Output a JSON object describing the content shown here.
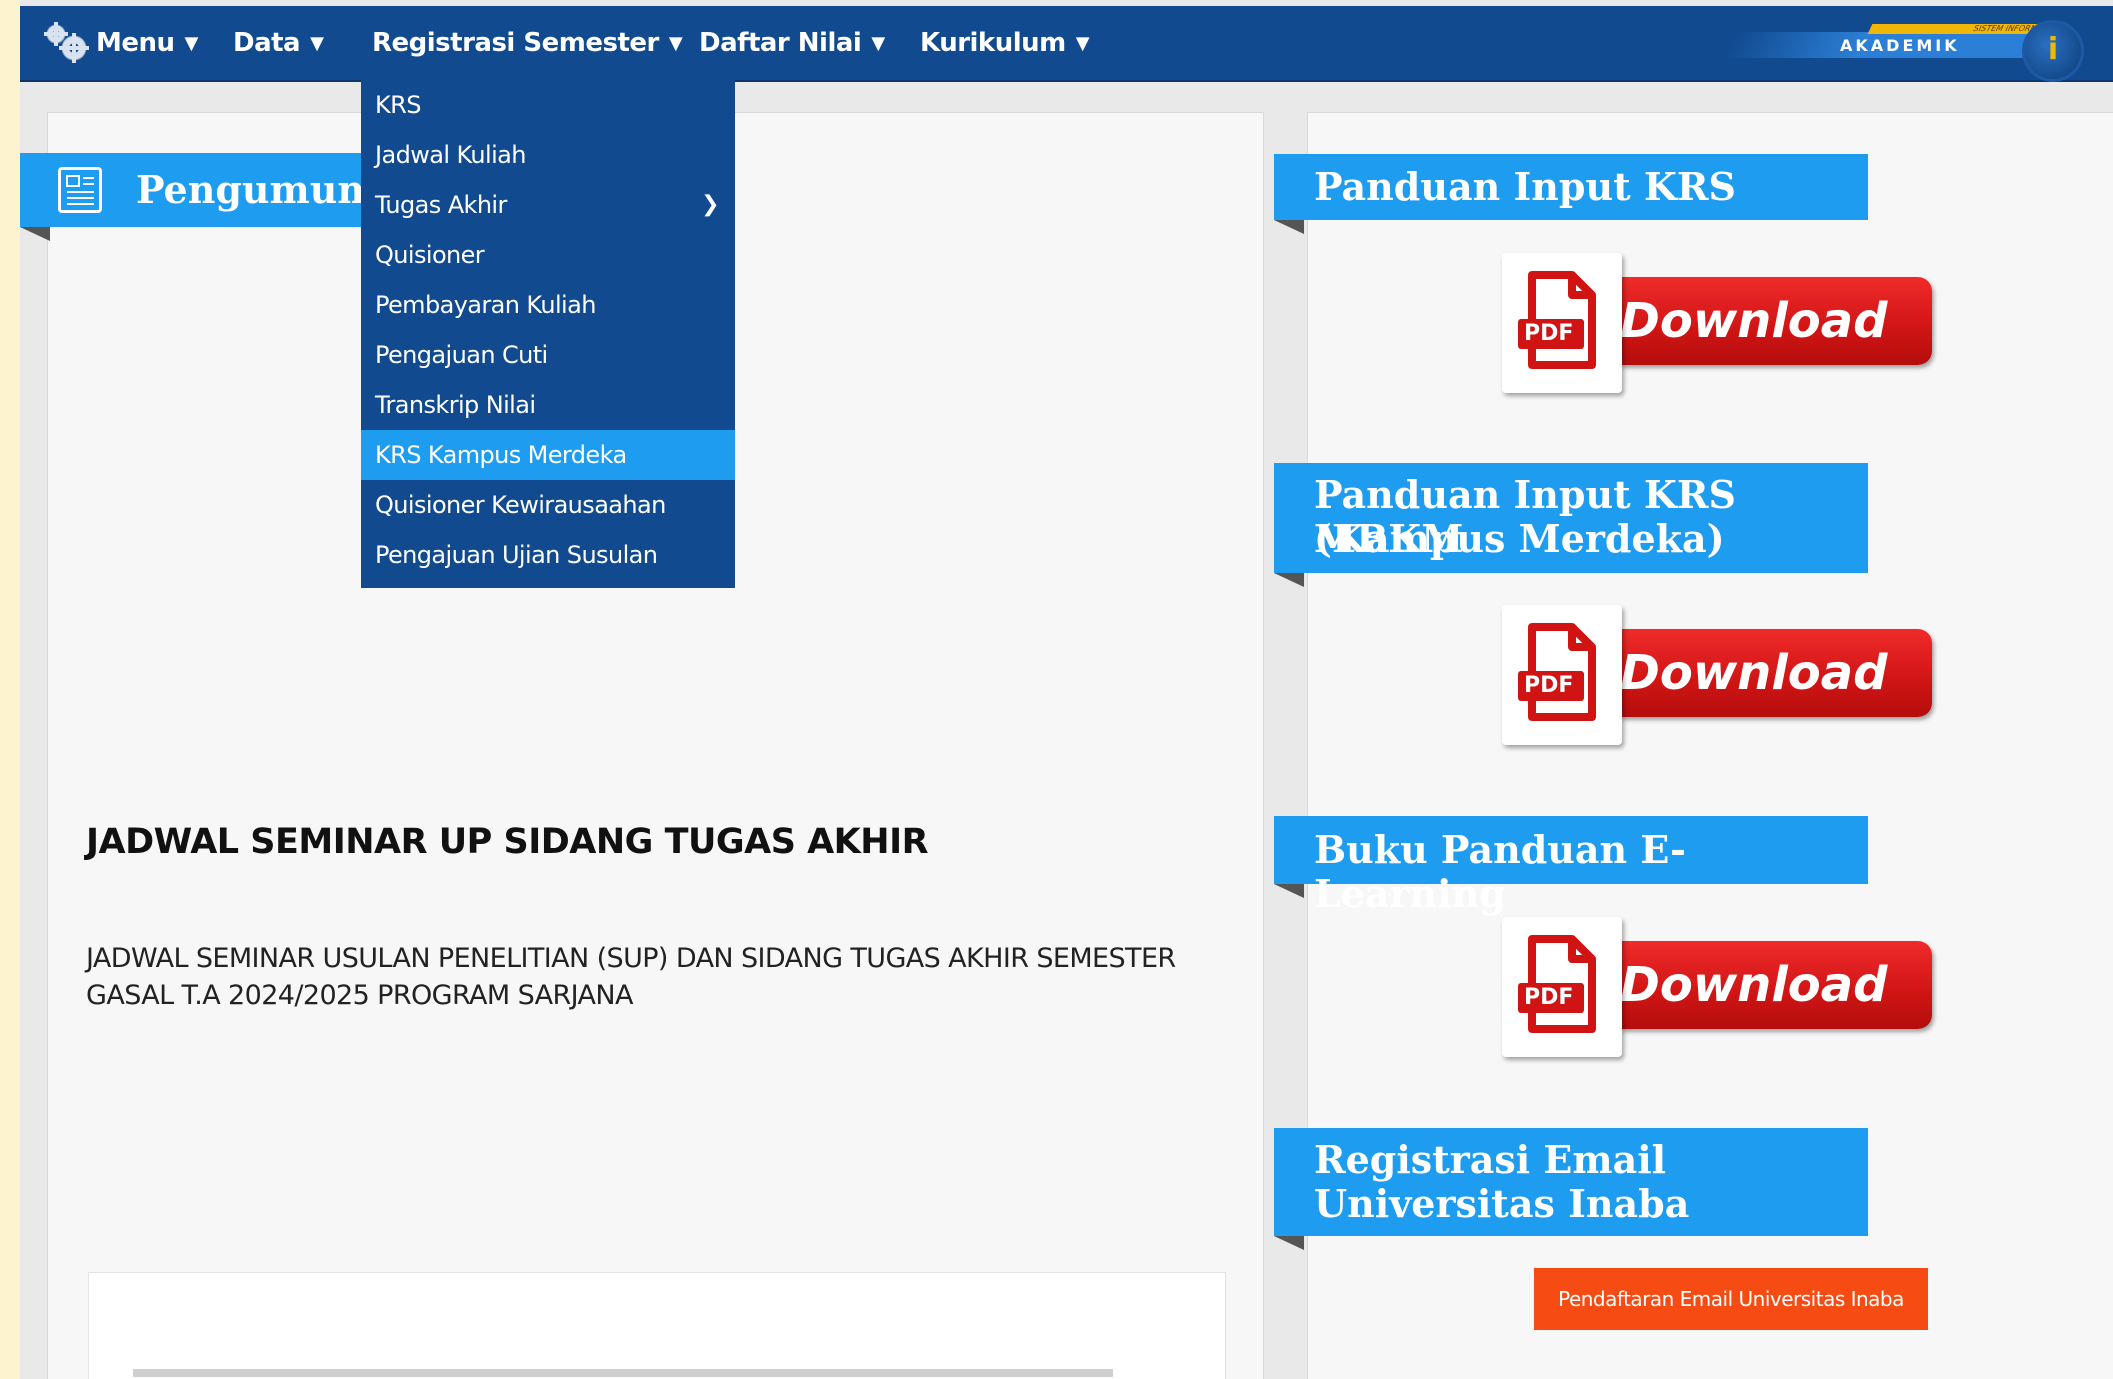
{
  "navbar": {
    "items": [
      {
        "label": "Menu"
      },
      {
        "label": "Data"
      },
      {
        "label": "Registrasi Semester"
      },
      {
        "label": "Daftar Nilai"
      },
      {
        "label": "Kurikulum"
      }
    ],
    "brand": {
      "label": "AKADEMIK",
      "small": "SISTEM INFORMASI",
      "badge": "i"
    }
  },
  "dropdown": {
    "items": [
      {
        "label": "KRS"
      },
      {
        "label": "Jadwal Kuliah"
      },
      {
        "label": "Tugas Akhir",
        "has_submenu": true
      },
      {
        "label": "Quisioner"
      },
      {
        "label": "Pembayaran Kuliah"
      },
      {
        "label": "Pengajuan Cuti"
      },
      {
        "label": "Transkrip Nilai"
      },
      {
        "label": "KRS Kampus Merdeka",
        "active": true
      },
      {
        "label": "Quisioner Kewirausaahan"
      },
      {
        "label": "Pengajuan Ujian Susulan"
      }
    ]
  },
  "announcement": {
    "title": "Pengumuman",
    "post_title": "JADWAL SEMINAR UP SIDANG TUGAS AKHIR",
    "post_body": "JADWAL SEMINAR USULAN PENELITIAN (SUP) DAN SIDANG TUGAS AKHIR SEMESTER GASAL T.A 2024/2025 PROGRAM SARJANA"
  },
  "sidebar": {
    "sections": [
      {
        "title": "Panduan Input KRS",
        "button": "Download",
        "doc_label": "PDF"
      },
      {
        "title_line1": "Panduan Input KRS MBKM",
        "title_line2": "(Kampus Merdeka)",
        "button": "Download",
        "doc_label": "PDF"
      },
      {
        "title": "Buku Panduan E-Learning",
        "button": "Download",
        "doc_label": "PDF"
      },
      {
        "title_line1": "Registrasi Email",
        "title_line2": "Universitas Inaba",
        "button": "Pendaftaran Email Universitas Inaba"
      }
    ]
  },
  "colors": {
    "navbar": "#114a8f",
    "accent": "#1e9cf0",
    "download_red": "#d01414",
    "email_button": "#f64b12",
    "page_border": "#fdf4cf"
  }
}
